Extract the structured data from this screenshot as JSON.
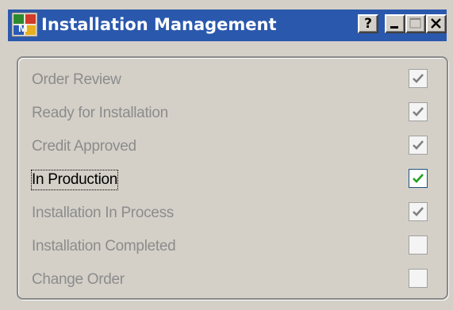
{
  "window": {
    "title": "Installation Management",
    "buttons": {
      "help": "?",
      "minimize": "minimize",
      "maximize": "maximize",
      "close": "close"
    },
    "title_bar_color": "#2a58ad",
    "icon": "app-grid-icon"
  },
  "items": [
    {
      "label": "Order Review",
      "checked": true,
      "enabled": false
    },
    {
      "label": "Ready for Installation",
      "checked": true,
      "enabled": false
    },
    {
      "label": "Credit Approved",
      "checked": true,
      "enabled": false
    },
    {
      "label": "In Production",
      "checked": true,
      "enabled": true,
      "focused": true
    },
    {
      "label": "Installation In Process",
      "checked": true,
      "enabled": false
    },
    {
      "label": "Installation Completed",
      "checked": false,
      "enabled": false
    },
    {
      "label": "Change Order",
      "checked": false,
      "enabled": false
    }
  ],
  "colors": {
    "disabled_text": "#8c8c8c",
    "enabled_check": "#21a121",
    "disabled_check": "#808080",
    "dialog_background": "#d4d0c8"
  }
}
